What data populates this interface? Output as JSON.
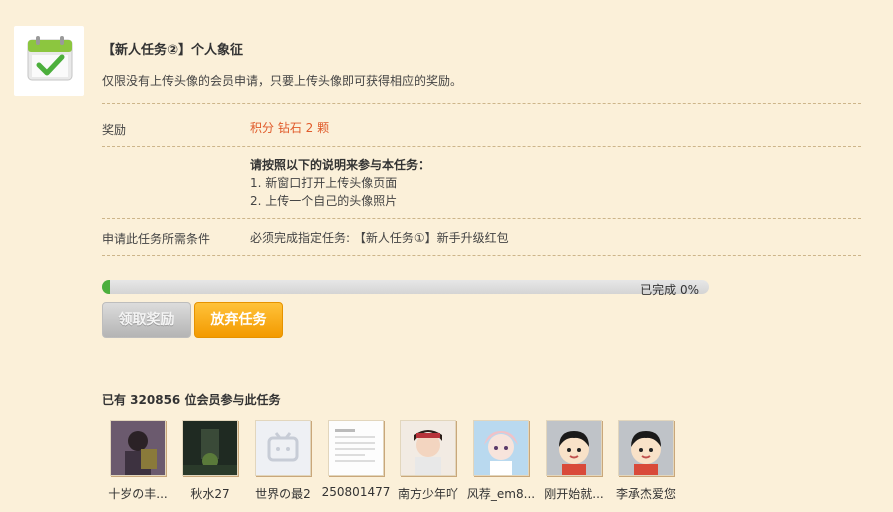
{
  "task": {
    "title": "【新人任务②】个人象征",
    "description": "仅限没有上传头像的会员申请，只要上传头像即可获得相应的奖励。"
  },
  "details": {
    "reward_label": "奖励",
    "reward_value": "积分 钻石 2 颗",
    "instructions_title": "请按照以下的说明来参与本任务：",
    "instruction_1": "1. 新窗口打开上传头像页面",
    "instruction_2": "2. 上传一个自己的头像照片",
    "requirement_label": "申请此任务所需条件",
    "requirement_value": "必须完成指定任务: 【新人任务①】新手升级红包"
  },
  "progress": {
    "text": "已完成 0%",
    "fraction": 0
  },
  "buttons": {
    "claim": "领取奖励",
    "abandon": "放弃任务"
  },
  "participants": {
    "summary": "已有 320856 位会员参与此任务",
    "members": [
      {
        "name": "十岁の丰..."
      },
      {
        "name": "秋水27"
      },
      {
        "name": "世界の最2"
      },
      {
        "name": "250801477"
      },
      {
        "name": "南方少年吖"
      },
      {
        "name": "风荐_em8..."
      },
      {
        "name": "刚开始就..."
      },
      {
        "name": "李承杰爱您"
      }
    ]
  },
  "colors": {
    "page_bg": "#fbf0d9",
    "reward": "#e05a2a",
    "progress_fill": "#4caf3c",
    "abandon_button": "#f39a00"
  }
}
